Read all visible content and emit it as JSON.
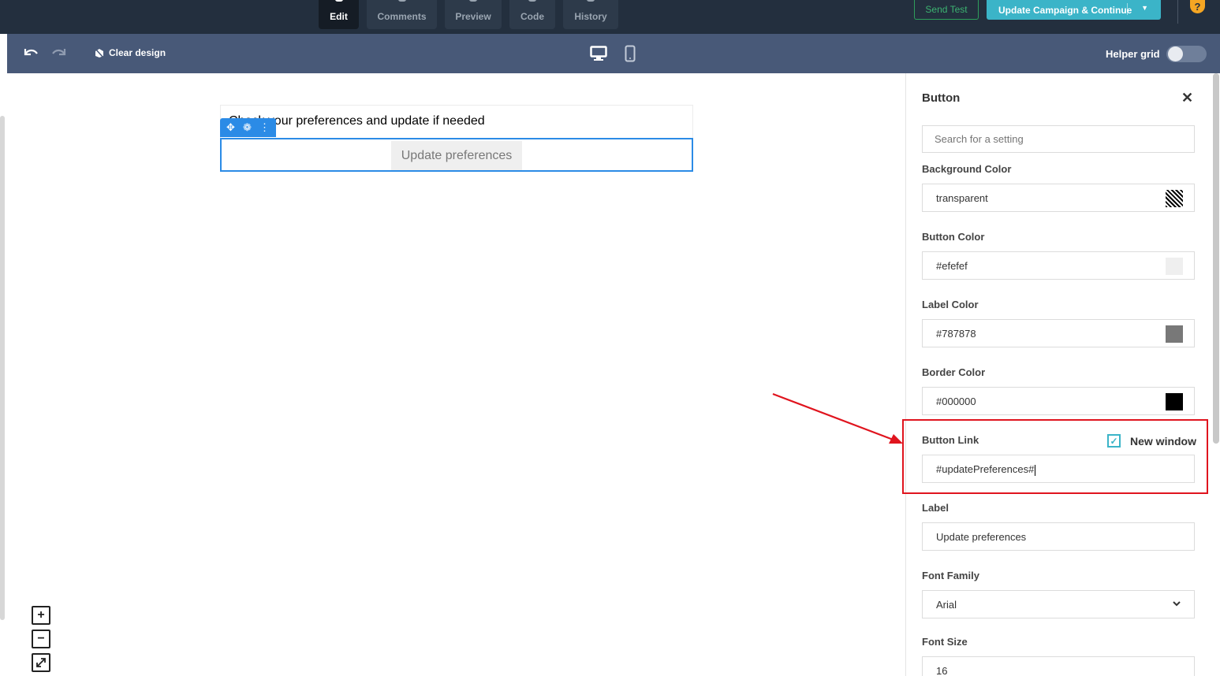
{
  "nav": {
    "tabs": [
      {
        "label": "Edit",
        "active": true
      },
      {
        "label": "Comments",
        "active": false
      },
      {
        "label": "Preview",
        "active": false
      },
      {
        "label": "Code",
        "active": false
      },
      {
        "label": "History",
        "active": false
      }
    ],
    "send_test": "Send Test",
    "update_campaign": "Update Campaign & Continue",
    "help": "?"
  },
  "toolbar": {
    "clear_design": "Clear design",
    "helper_grid": "Helper grid",
    "helper_grid_on": false
  },
  "canvas": {
    "text_block": "Check your preferences and update if needed",
    "button_label": "Update preferences",
    "zoom_in": "+",
    "zoom_out": "−"
  },
  "panel": {
    "title": "Button",
    "search_placeholder": "Search for a setting",
    "background_color_label": "Background Color",
    "background_color_value": "transparent",
    "button_color_label": "Button Color",
    "button_color_value": "#efefef",
    "label_color_label": "Label Color",
    "label_color_value": "#787878",
    "border_color_label": "Border Color",
    "border_color_value": "#000000",
    "button_link_label": "Button Link",
    "new_window_label": "New window",
    "new_window_checked": true,
    "button_link_value": "#updatePreferences#",
    "label_label": "Label",
    "label_value": "Update preferences",
    "font_family_label": "Font Family",
    "font_family_value": "Arial",
    "font_size_label": "Font Size",
    "font_size_value": "16"
  },
  "colors": {
    "accent": "#3bb4c8",
    "selection": "#2b8be6",
    "annotation": "#e0141e"
  }
}
